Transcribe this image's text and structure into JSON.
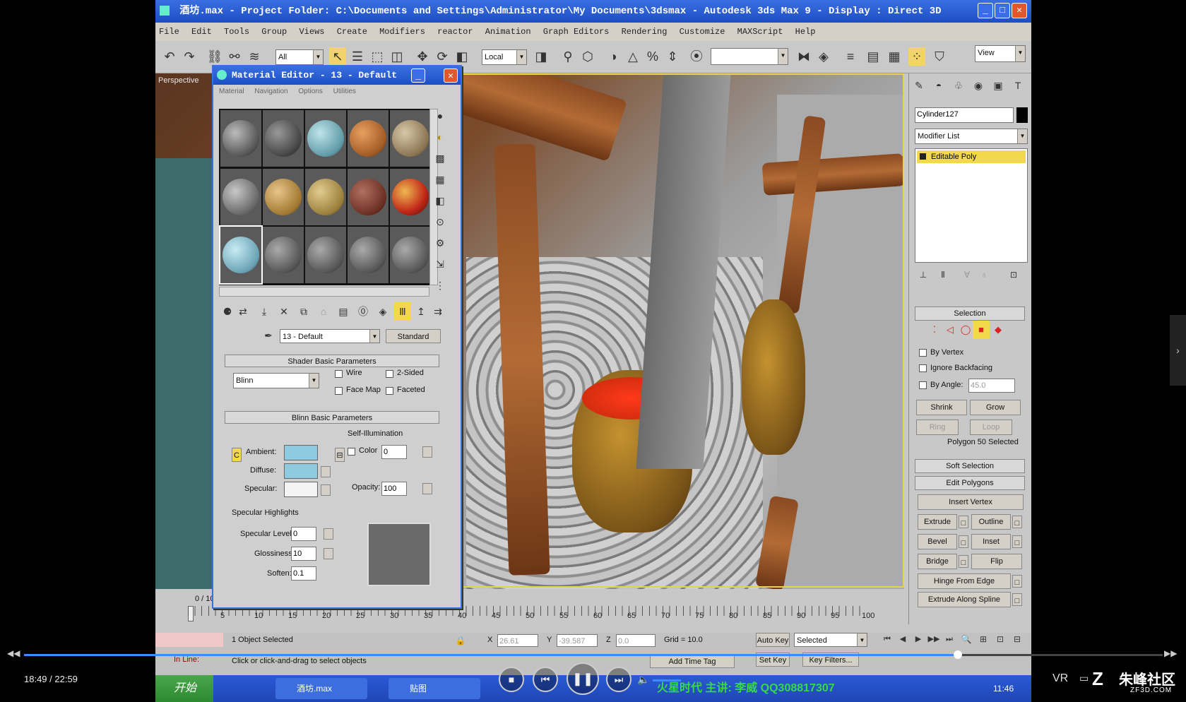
{
  "window": {
    "title": "酒坊.max - Project Folder: C:\\Documents and Settings\\Administrator\\My Documents\\3dsmax - Autodesk 3ds Max 9 - Display : Direct 3D"
  },
  "menu": [
    "File",
    "Edit",
    "Tools",
    "Group",
    "Views",
    "Create",
    "Modifiers",
    "reactor",
    "Animation",
    "Graph Editors",
    "Rendering",
    "Customize",
    "MAXScript",
    "Help"
  ],
  "toolbar": {
    "selection_filter": "All",
    "coord_system": "Local",
    "view": "View"
  },
  "viewport": {
    "label": "Perspective"
  },
  "material_editor": {
    "title": "Material Editor - 13 - Default",
    "menu": [
      "Material",
      "Navigation",
      "Options",
      "Utilities"
    ],
    "material_name": "13 - Default",
    "material_type": "Standard",
    "shader_rollout": "Shader Basic Parameters",
    "shader_type": "Blinn",
    "wire": "Wire",
    "two_sided": "2-Sided",
    "face_map": "Face Map",
    "faceted": "Faceted",
    "blinn_rollout": "Blinn Basic Parameters",
    "self_illum": "Self-Illumination",
    "ambient": "Ambient:",
    "diffuse": "Diffuse:",
    "specular": "Specular:",
    "color": "Color",
    "color_value": "0",
    "opacity": "Opacity:",
    "opacity_value": "100",
    "spec_highlights": "Specular Highlights",
    "spec_level": "Specular Level:",
    "spec_level_value": "0",
    "glossiness": "Glossiness:",
    "glossiness_value": "10",
    "soften": "Soften:",
    "soften_value": "0.1",
    "ambient_color": "#8ecbe0",
    "diffuse_color": "#8ecbe0",
    "specular_color": "#f4f4f4"
  },
  "command_panel": {
    "object_name": "Cylinder127",
    "modifier_list": "Modifier List",
    "stack_item": "Editable Poly",
    "selection": "Selection",
    "by_vertex": "By Vertex",
    "ignore_backfacing": "Ignore Backfacing",
    "by_angle": "By Angle:",
    "by_angle_value": "45.0",
    "shrink": "Shrink",
    "grow": "Grow",
    "ring": "Ring",
    "loop": "Loop",
    "poly_selected": "Polygon 50 Selected",
    "soft_selection": "Soft Selection",
    "edit_polygons": "Edit Polygons",
    "insert_vertex": "Insert Vertex",
    "extrude": "Extrude",
    "outline": "Outline",
    "bevel": "Bevel",
    "inset": "Inset",
    "bridge": "Bridge",
    "flip": "Flip",
    "hinge": "Hinge From Edge",
    "extrude_spline": "Extrude Along Spline"
  },
  "timeline": {
    "frame": "0 / 100",
    "ticks": [
      "5",
      "10",
      "15",
      "20",
      "25",
      "30",
      "35",
      "40",
      "45",
      "50",
      "55",
      "60",
      "65",
      "70",
      "75",
      "80",
      "85",
      "90",
      "95",
      "100"
    ]
  },
  "status": {
    "selected": "1 Object Selected",
    "prompt": "Click or click-and-drag to select objects",
    "x_label": "X",
    "x_value": "26.61",
    "y_label": "Y",
    "y_value": "-39.587",
    "z_label": "Z",
    "z_value": "0.0",
    "grid": "Grid = 10.0",
    "auto_key": "Auto Key",
    "set_key": "Set Key",
    "selected_dropdown": "Selected",
    "key_filters": "Key Filters...",
    "add_time_tag": "Add Time Tag",
    "in_line": "In Line:"
  },
  "taskbar": {
    "start": "开始",
    "task": "酒坊.max",
    "folder": "贴图",
    "marquee": "火星时代 主讲: 李威 QQ308817307",
    "clock": "11:46"
  },
  "player": {
    "time": "18:49 / 22:59",
    "vr": "VR",
    "brand": "朱峰社区",
    "brand_sub": "ZF3D.COM",
    "progress": 0.82
  }
}
